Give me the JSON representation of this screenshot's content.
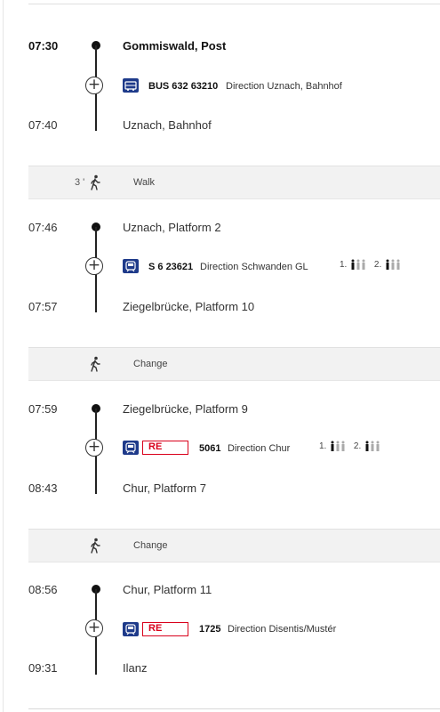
{
  "legs": [
    {
      "dep_time": "07:30",
      "dep_stop": "Gommiswald, Post",
      "mode": "bus-icon",
      "product": "",
      "line": "BUS 632 63210",
      "direction": "Direction Uznach, Bahnhof",
      "arr_time": "07:40",
      "arr_stop": "Uznach, Bahnhof",
      "occupancy": []
    },
    {
      "dep_time": "07:46",
      "dep_stop": "Uznach, Platform 2",
      "mode": "train-icon",
      "product": "",
      "line": "S 6 23621",
      "direction": "Direction Schwanden GL",
      "arr_time": "07:57",
      "arr_stop": "Ziegelbrücke, Platform 10",
      "occupancy": [
        {
          "class_label": "1."
        },
        {
          "class_label": "2."
        }
      ]
    },
    {
      "dep_time": "07:59",
      "dep_stop": "Ziegelbrücke, Platform 9",
      "mode": "train-icon",
      "product": "RE",
      "line": "5061",
      "direction": "Direction Chur",
      "arr_time": "08:43",
      "arr_stop": "Chur, Platform 7",
      "occupancy": [
        {
          "class_label": "1."
        },
        {
          "class_label": "2."
        }
      ]
    },
    {
      "dep_time": "08:56",
      "dep_stop": "Chur, Platform 11",
      "mode": "train-icon",
      "product": "RE",
      "line": "1725",
      "direction": "Direction Disentis/Mustér",
      "arr_time": "09:31",
      "arr_stop": "Ilanz",
      "occupancy": []
    }
  ],
  "transfers": [
    {
      "duration": "3 '",
      "label": "Walk",
      "icon": "walk-icon"
    },
    {
      "duration": "",
      "label": "Change",
      "icon": "walk-icon"
    },
    {
      "duration": "",
      "label": "Change",
      "icon": "walk-icon"
    }
  ],
  "colors": {
    "accent": "#1e3a8a",
    "product_red": "#d9001b",
    "band": "#f2f2f2"
  }
}
